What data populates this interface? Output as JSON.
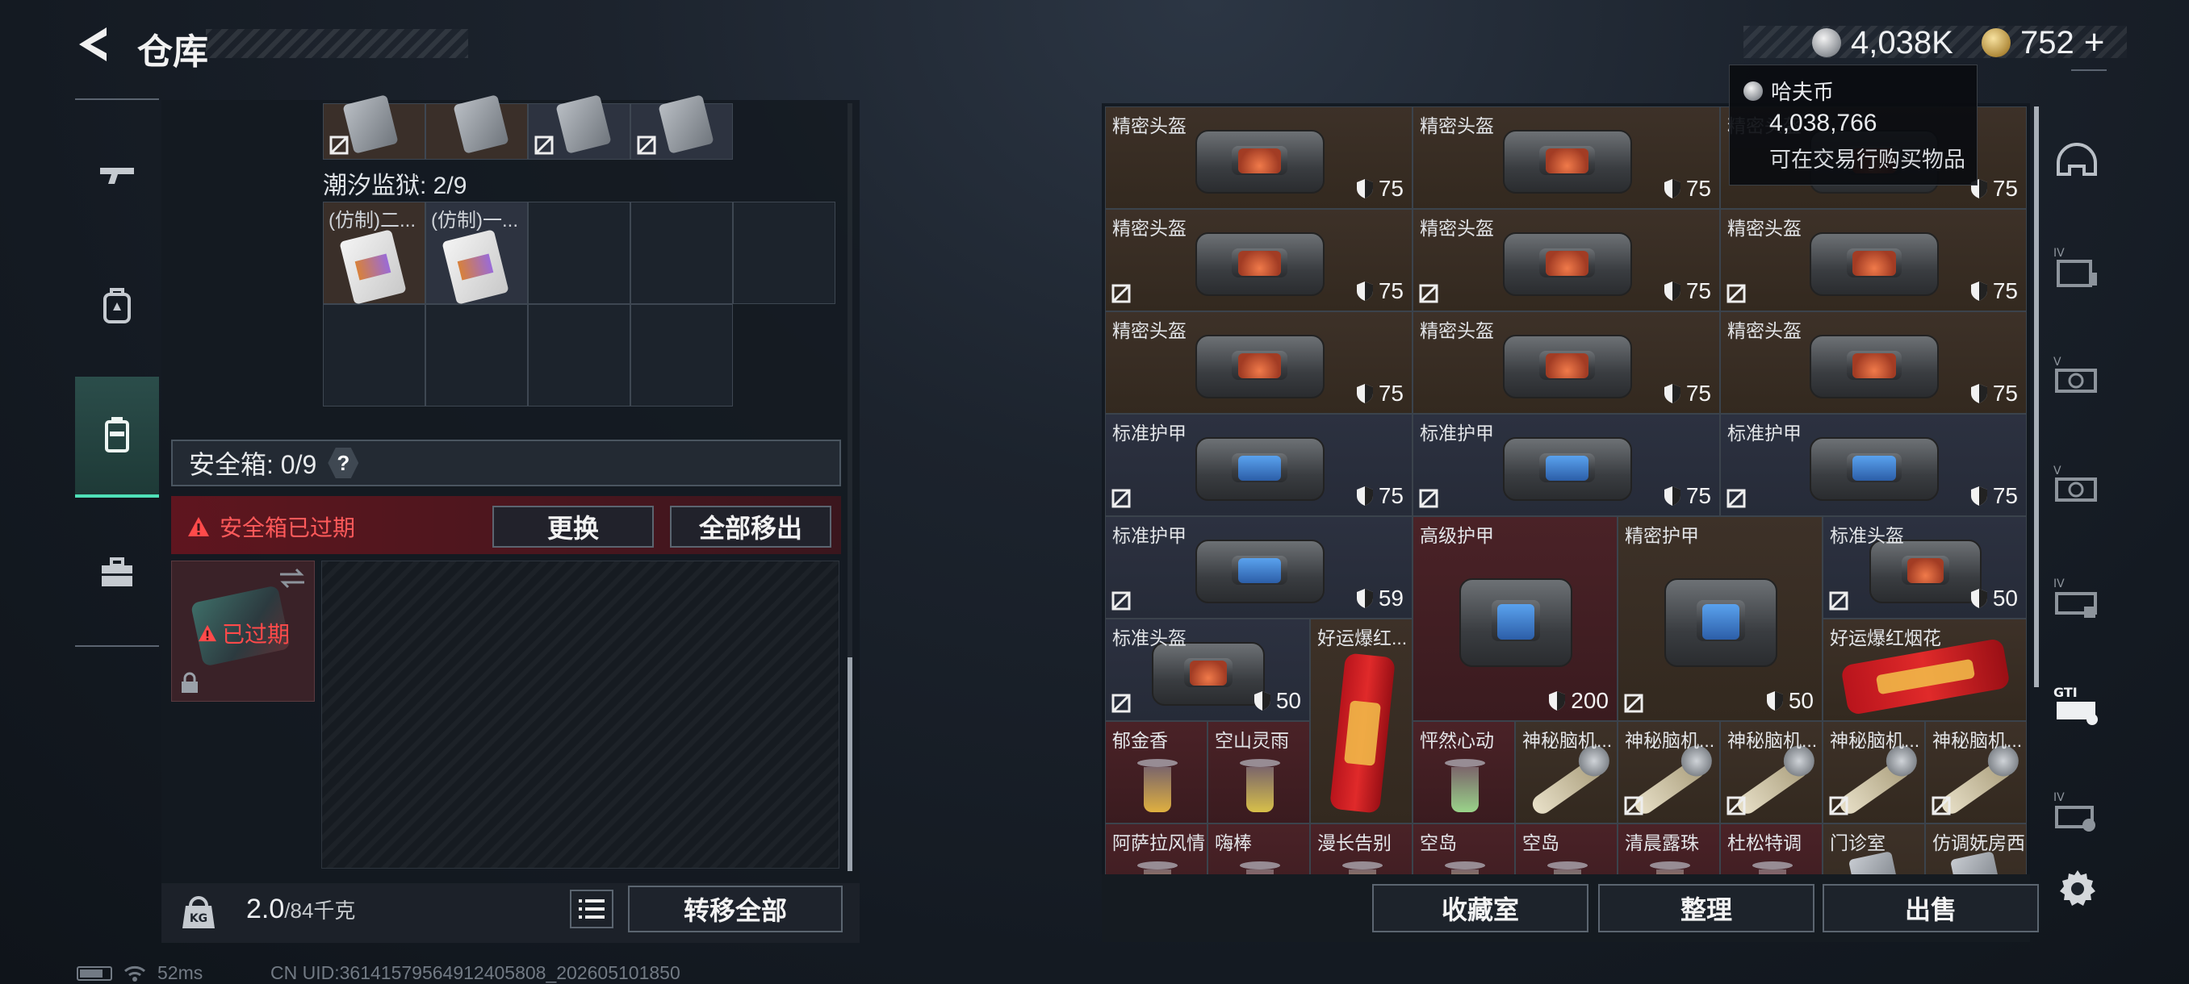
{
  "header": {
    "title": "仓库"
  },
  "currency": {
    "haf_coin": "4,038K",
    "premium": "752",
    "plus": "+"
  },
  "tooltip": {
    "title": "哈夫币",
    "value": "4,038,766",
    "desc": "可在交易行购买物品"
  },
  "left": {
    "section_label": "潮汐监狱: 2/9",
    "cards": [
      "(仿制)二...",
      "(仿制)一..."
    ],
    "safebox_label": "安全箱: 0/9",
    "help": "?",
    "expired_msg": "安全箱已过期",
    "btn_replace": "更换",
    "btn_remove_all": "全部移出",
    "thumb_expired": "已过期",
    "weight_value": "2.0",
    "weight_capacity": "/84千克",
    "btn_transfer_all": "转移全部"
  },
  "inventory": [
    {
      "name": "精密头盔",
      "durability": "75",
      "tint": "brown",
      "kind": "helmet"
    },
    {
      "name": "精密头盔",
      "durability": "75",
      "tint": "brown",
      "kind": "helmet"
    },
    {
      "name": "精密头盔",
      "durability": "75",
      "tint": "brown",
      "kind": "helmet"
    },
    {
      "name": "精密头盔",
      "durability": "75",
      "tint": "brown",
      "kind": "helmet"
    },
    {
      "name": "精密头盔",
      "durability": "75",
      "tint": "brown",
      "kind": "helmet"
    },
    {
      "name": "精密头盔",
      "durability": "75",
      "tint": "brown",
      "kind": "helmet"
    },
    {
      "name": "精密头盔",
      "durability": "75",
      "tint": "brown",
      "kind": "helmet"
    },
    {
      "name": "精密头盔",
      "durability": "75",
      "tint": "brown",
      "kind": "helmet"
    },
    {
      "name": "精密头盔",
      "durability": "75",
      "tint": "brown",
      "kind": "helmet"
    },
    {
      "name": "标准护甲",
      "durability": "75",
      "tint": "blue",
      "kind": "armor"
    },
    {
      "name": "标准护甲",
      "durability": "75",
      "tint": "blue",
      "kind": "armor"
    },
    {
      "name": "标准护甲",
      "durability": "75",
      "tint": "blue",
      "kind": "armor"
    },
    {
      "name": "标准护甲",
      "durability": "59",
      "tint": "blue",
      "kind": "armor"
    },
    {
      "name": "高级护甲",
      "durability": "200",
      "tint": "red",
      "kind": "armor"
    },
    {
      "name": "精密护甲",
      "durability": "50",
      "tint": "brown",
      "kind": "armor"
    },
    {
      "name": "标准头盔",
      "durability": "50",
      "tint": "blue",
      "kind": "helmet"
    },
    {
      "name": "标准头盔",
      "durability": "50",
      "tint": "blue",
      "kind": "helmet"
    },
    {
      "name": "好运爆红...",
      "durability": "",
      "tint": "brown",
      "kind": "firecracker"
    },
    {
      "name": "好运爆红烟花",
      "durability": "",
      "tint": "brown",
      "kind": "firecracker"
    },
    {
      "name": "郁金香",
      "durability": "",
      "tint": "red",
      "kind": "drink"
    },
    {
      "name": "空山灵雨",
      "durability": "",
      "tint": "red",
      "kind": "drink"
    },
    {
      "name": "怦然心动",
      "durability": "",
      "tint": "red",
      "kind": "drink"
    },
    {
      "name": "神秘脑机...",
      "durability": "",
      "tint": "brown",
      "kind": "lamp"
    },
    {
      "name": "神秘脑机...",
      "durability": "",
      "tint": "brown",
      "kind": "lamp"
    },
    {
      "name": "神秘脑机...",
      "durability": "",
      "tint": "brown",
      "kind": "lamp"
    },
    {
      "name": "神秘脑机...",
      "durability": "",
      "tint": "brown",
      "kind": "lamp"
    },
    {
      "name": "神秘脑机...",
      "durability": "",
      "tint": "brown",
      "kind": "lamp"
    },
    {
      "name": "阿萨拉风情",
      "durability": "",
      "tint": "red",
      "kind": "drink"
    },
    {
      "name": "嗨棒",
      "durability": "",
      "tint": "red",
      "kind": "drink"
    },
    {
      "name": "漫长告别",
      "durability": "",
      "tint": "red",
      "kind": "drink"
    },
    {
      "name": "空岛",
      "durability": "",
      "tint": "red",
      "kind": "drink"
    },
    {
      "name": "空岛",
      "durability": "",
      "tint": "red",
      "kind": "drink"
    },
    {
      "name": "清晨露珠",
      "durability": "",
      "tint": "red",
      "kind": "drink"
    },
    {
      "name": "杜松特调",
      "durability": "",
      "tint": "red",
      "kind": "drink"
    },
    {
      "name": "门诊室",
      "durability": "",
      "tint": "brown",
      "kind": "card"
    },
    {
      "name": "仿调妩房西",
      "durability": "",
      "tint": "brown",
      "kind": "card"
    }
  ],
  "right_buttons": {
    "collection": "收藏室",
    "sort": "整理",
    "sell": "出售"
  },
  "status": {
    "ping": "52ms",
    "uid": "CN UID:36141579564912405808_202605101850"
  }
}
